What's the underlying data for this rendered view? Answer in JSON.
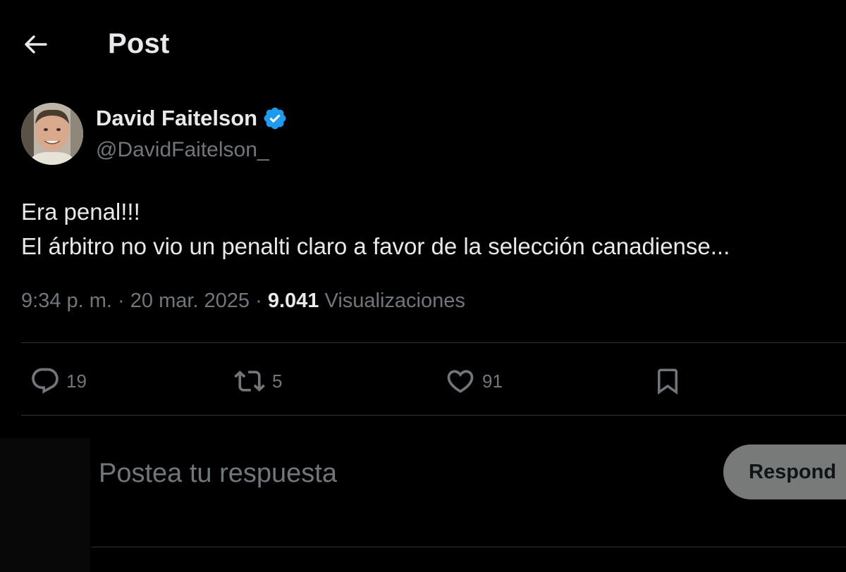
{
  "header": {
    "back_icon": "arrow-left-icon",
    "title": "Post"
  },
  "author": {
    "name": "David Faitelson",
    "handle": "@DavidFaitelson_",
    "verified_icon": "verified-badge-icon",
    "verified_color": "#1d9bf0"
  },
  "tweet": {
    "line1": "Era penal!!!",
    "line2": "El árbitro no vio un penalti claro a favor de la selección canadiense..."
  },
  "meta": {
    "time": "9:34 p. m.",
    "separator": "·",
    "date": "20 mar. 2025",
    "views_count": "9.041",
    "views_label": "Visualizaciones"
  },
  "actions": {
    "reply": {
      "icon": "reply-icon",
      "count": "19"
    },
    "repost": {
      "icon": "repost-icon",
      "count": "5"
    },
    "like": {
      "icon": "heart-icon",
      "count": "91"
    },
    "bookmark": {
      "icon": "bookmark-icon"
    }
  },
  "composer": {
    "placeholder": "Postea tu respuesta",
    "button_label": "Respond"
  },
  "colors": {
    "background": "#000000",
    "text_primary": "#e7e9ea",
    "text_secondary": "#71767b",
    "divider": "#2f3336",
    "button_bg": "#787a7a"
  }
}
